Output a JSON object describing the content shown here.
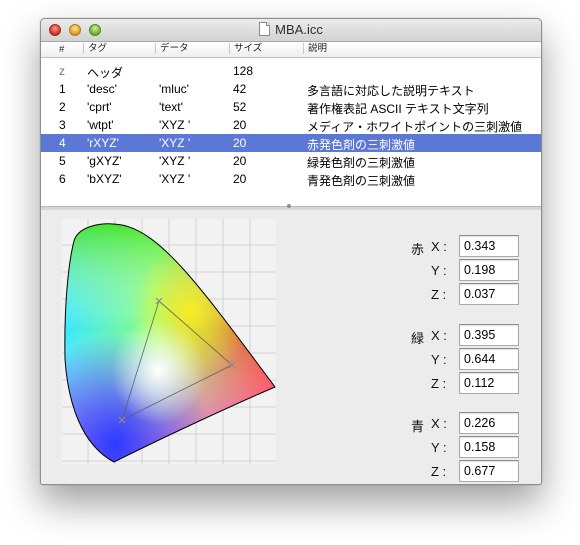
{
  "window": {
    "title": "MBA.icc"
  },
  "table": {
    "headers": [
      "#",
      "タグ",
      "データ",
      "サイズ",
      "説明"
    ],
    "rows": [
      {
        "no": "z",
        "tag": "ヘッダ",
        "data": "",
        "size": "128",
        "desc": ""
      },
      {
        "no": "1",
        "tag": "'desc'",
        "data": "'mluc'",
        "size": "42",
        "desc": "多言語に対応した説明テキスト"
      },
      {
        "no": "2",
        "tag": "'cprt'",
        "data": "'text'",
        "size": "52",
        "desc": "著作権表記 ASCII テキスト文字列"
      },
      {
        "no": "3",
        "tag": "'wtpt'",
        "data": "'XYZ '",
        "size": "20",
        "desc": "メディア・ホワイトポイントの三刺激値"
      },
      {
        "no": "4",
        "tag": "'rXYZ'",
        "data": "'XYZ '",
        "size": "20",
        "desc": "赤発色剤の三刺激値"
      },
      {
        "no": "5",
        "tag": "'gXYZ'",
        "data": "'XYZ '",
        "size": "20",
        "desc": "緑発色剤の三刺激値"
      },
      {
        "no": "6",
        "tag": "'bXYZ'",
        "data": "'XYZ '",
        "size": "20",
        "desc": "青発色剤の三刺激値"
      }
    ],
    "selected_row_color": "#5b78d6"
  },
  "values": {
    "red": {
      "label": "赤",
      "x_label": "X :",
      "y_label": "Y :",
      "z_label": "Z :",
      "x": "0.343",
      "y": "0.198",
      "z": "0.037"
    },
    "green": {
      "label": "緑",
      "x_label": "X :",
      "y_label": "Y :",
      "z_label": "Z :",
      "x": "0.395",
      "y": "0.644",
      "z": "0.112"
    },
    "blue": {
      "label": "青",
      "x_label": "X :",
      "y_label": "Y :",
      "z_label": "Z :",
      "x": "0.226",
      "y": "0.158",
      "z": "0.677"
    }
  },
  "icons": {
    "close": "close-icon",
    "minimize": "minimize-icon",
    "zoom": "zoom-icon",
    "document": "document-icon"
  }
}
